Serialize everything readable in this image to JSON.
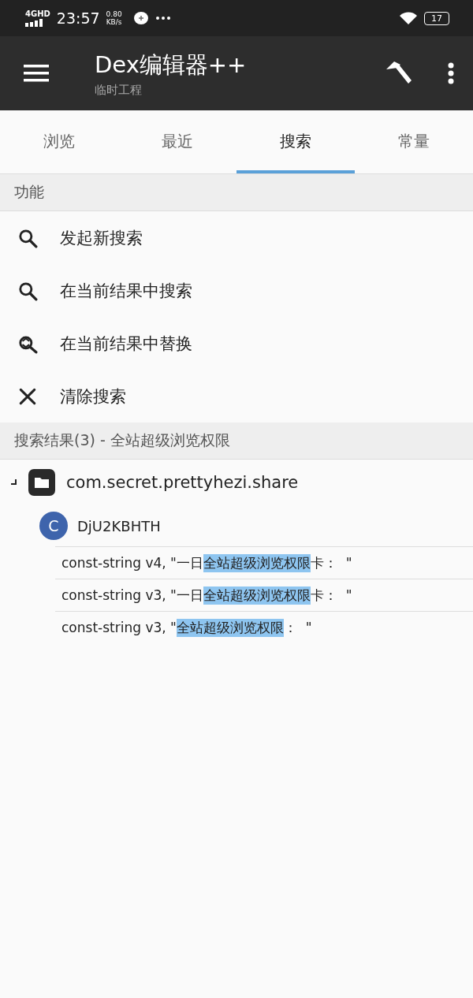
{
  "status_bar": {
    "network": "4G",
    "network_badge": "HD",
    "time": "23:57",
    "speed_value": "0.80",
    "speed_unit": "KB/s",
    "battery": "17"
  },
  "app_bar": {
    "title": "Dex编辑器++",
    "subtitle": "临时工程"
  },
  "tabs": [
    {
      "label": "浏览",
      "selected": false
    },
    {
      "label": "最近",
      "selected": false
    },
    {
      "label": "搜索",
      "selected": true
    },
    {
      "label": "常量",
      "selected": false
    }
  ],
  "functions_header": "功能",
  "actions": [
    {
      "kind": "search",
      "label": "发起新搜索"
    },
    {
      "kind": "search",
      "label": "在当前结果中搜索"
    },
    {
      "kind": "replace",
      "label": "在当前结果中替换"
    },
    {
      "kind": "clear",
      "label": "清除搜索"
    }
  ],
  "results_header": "搜索结果(3) - 全站超级浏览权限",
  "tree": [
    {
      "label": "com.secret.prettyhezi.share",
      "expanded": true,
      "children": [
        {
          "badge": "C",
          "label": "DjU2KBHTH",
          "matches": [
            {
              "before": "const-string v4, \"一日",
              "match": "全站超级浏览权限",
              "after": "卡：  \""
            },
            {
              "before": "const-string v3, \"一日",
              "match": "全站超级浏览权限",
              "after": "卡：  \""
            },
            {
              "before": "const-string v3, \"",
              "match": "全站超级浏览权限",
              "after": "：  \""
            }
          ]
        }
      ]
    }
  ]
}
